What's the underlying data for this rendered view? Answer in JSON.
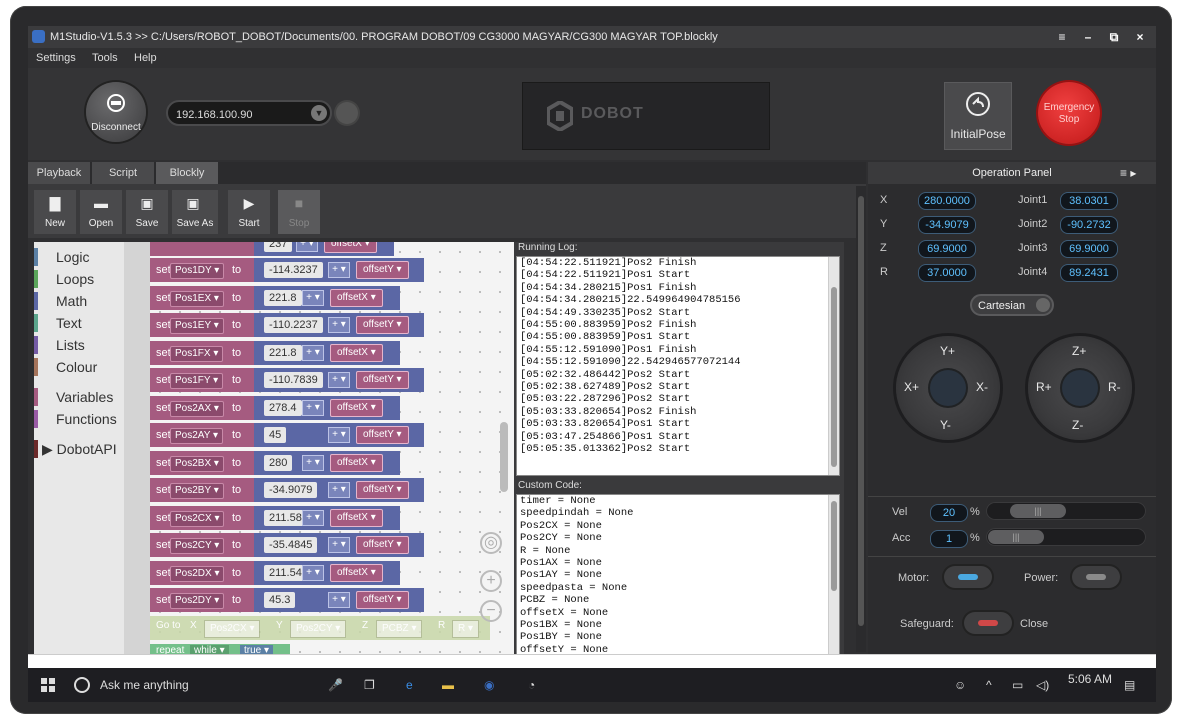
{
  "window": {
    "title": "M1Studio-V1.5.3 >> C:/Users/ROBOT_DOBOT/Documents/00. PROGRAM DOBOT/09 CG3000 MAGYAR/CG300 MAGYAR TOP.blockly",
    "controls": [
      "≡",
      "–",
      "⧉",
      "×"
    ]
  },
  "menu": {
    "settings": "Settings",
    "tools": "Tools",
    "help": "Help"
  },
  "connection": {
    "disconnect_label": "Disconnect",
    "ip": "192.168.100.90"
  },
  "brand": {
    "name": "DOBOT"
  },
  "actions": {
    "initial_pose": "InitialPose",
    "emergency_line1": "Emergency",
    "emergency_line2": "Stop"
  },
  "tabs": {
    "playback": "Playback",
    "script": "Script",
    "blockly": "Blockly"
  },
  "toolbar": {
    "new": "New",
    "open": "Open",
    "save": "Save",
    "save_as": "Save As",
    "start": "Start",
    "stop": "Stop"
  },
  "categories": [
    {
      "label": "Logic",
      "color": "#5b80a5"
    },
    {
      "label": "Loops",
      "color": "#5ba55b"
    },
    {
      "label": "Math",
      "color": "#5b67a5"
    },
    {
      "label": "Text",
      "color": "#5ba58c"
    },
    {
      "label": "Lists",
      "color": "#745ba5"
    },
    {
      "label": "Colour",
      "color": "#a5745b"
    },
    {
      "label": "Variables",
      "color": "#a55b80"
    },
    {
      "label": "Functions",
      "color": "#995ba5"
    },
    {
      "label": "▶ DobotAPI",
      "color": "#6b2a2a"
    }
  ],
  "blocks": {
    "top_partial": {
      "value": "237",
      "op": "+ ▾",
      "offset": "offsetX ▾"
    },
    "rows": [
      {
        "set": "set",
        "var": "Pos1DY ▾",
        "to": "to",
        "value": "-114.3237",
        "op": "+ ▾",
        "offset": "offsetY ▾"
      },
      {
        "set": "set",
        "var": "Pos1EX ▾",
        "to": "to",
        "value": "221.8",
        "op": "+ ▾",
        "offset": "offsetX ▾"
      },
      {
        "set": "set",
        "var": "Pos1EY ▾",
        "to": "to",
        "value": "-110.2237",
        "op": "+ ▾",
        "offset": "offsetY ▾"
      },
      {
        "set": "set",
        "var": "Pos1FX ▾",
        "to": "to",
        "value": "221.8",
        "op": "+ ▾",
        "offset": "offsetX ▾"
      },
      {
        "set": "set",
        "var": "Pos1FY ▾",
        "to": "to",
        "value": "-110.7839",
        "op": "+ ▾",
        "offset": "offsetY ▾"
      },
      {
        "set": "set",
        "var": "Pos2AX ▾",
        "to": "to",
        "value": "278.4",
        "op": "+ ▾",
        "offset": "offsetX ▾"
      },
      {
        "set": "set",
        "var": "Pos2AY ▾",
        "to": "to",
        "value": "45",
        "op": "+ ▾",
        "offset": "offsetY ▾"
      },
      {
        "set": "set",
        "var": "Pos2BX ▾",
        "to": "to",
        "value": "280",
        "op": "+ ▾",
        "offset": "offsetX ▾"
      },
      {
        "set": "set",
        "var": "Pos2BY ▾",
        "to": "to",
        "value": "-34.9079",
        "op": "+ ▾",
        "offset": "offsetY ▾"
      },
      {
        "set": "set",
        "var": "Pos2CX ▾",
        "to": "to",
        "value": "211.58",
        "op": "+ ▾",
        "offset": "offsetX ▾"
      },
      {
        "set": "set",
        "var": "Pos2CY ▾",
        "to": "to",
        "value": "-35.4845",
        "op": "+ ▾",
        "offset": "offsetY ▾"
      },
      {
        "set": "set",
        "var": "Pos2DX ▾",
        "to": "to",
        "value": "211.54",
        "op": "+ ▾",
        "offset": "offsetX ▾"
      },
      {
        "set": "set",
        "var": "Pos2DY ▾",
        "to": "to",
        "value": "45.3",
        "op": "+ ▾",
        "offset": "offsetY ▾"
      }
    ],
    "goto": {
      "label": "Go to",
      "x": "X",
      "xv": "Pos2CX ▾",
      "y": "Y",
      "yv": "Pos2CY ▾",
      "z": "Z",
      "zv": "PCBZ ▾",
      "r": "R",
      "rv": "R ▾"
    },
    "repeat": {
      "label": "repeat",
      "mode": "while ▾",
      "cond": "true ▾"
    }
  },
  "running_log": {
    "label": "Running Log:",
    "lines": [
      "[04:54:22.511921]Pos2 Finish",
      "[04:54:22.511921]Pos1 Start",
      "[04:54:34.280215]Pos1 Finish",
      "[04:54:34.280215]22.549964904785156",
      "[04:54:49.330235]Pos2 Start",
      "[04:55:00.883959]Pos2 Finish",
      "[04:55:00.883959]Pos1 Start",
      "[04:55:12.591090]Pos1 Finish",
      "[04:55:12.591090]22.542946577072144",
      "[05:02:32.486442]Pos2 Start",
      "[05:02:38.627489]Pos2 Start",
      "[05:03:22.287296]Pos2 Start",
      "[05:03:33.820654]Pos2 Finish",
      "[05:03:33.820654]Pos1 Start",
      "[05:03:47.254866]Pos1 Start",
      "[05:05:35.013362]Pos2 Start"
    ]
  },
  "custom_code": {
    "label": "Custom Code:",
    "lines": [
      "timer = None",
      "speedpindah = None",
      "Pos2CX = None",
      "Pos2CY = None",
      "R = None",
      "Pos1AX = None",
      "Pos1AY = None",
      "speedpasta = None",
      "PCBZ = None",
      "offsetX = None",
      "Pos1BX = None",
      "Pos1BY = None",
      "offsetY = None"
    ]
  },
  "operation_panel": {
    "title": "Operation Panel",
    "coords": [
      {
        "axis": "X",
        "value": "280.0000",
        "joint": "Joint1",
        "jvalue": "38.0301"
      },
      {
        "axis": "Y",
        "value": "-34.9079",
        "joint": "Joint2",
        "jvalue": "-90.2732"
      },
      {
        "axis": "Z",
        "value": "69.9000",
        "joint": "Joint3",
        "jvalue": "69.9000"
      },
      {
        "axis": "R",
        "value": "37.0000",
        "joint": "Joint4",
        "jvalue": "89.2431"
      }
    ],
    "mode": "Cartesian",
    "jog_xy": {
      "up": "Y+",
      "down": "Y-",
      "left": "X+",
      "right": "X-"
    },
    "jog_zr": {
      "up": "Z+",
      "down": "Z-",
      "left": "R+",
      "right": "R-"
    },
    "vel": {
      "label": "Vel",
      "value": "20",
      "unit": "%"
    },
    "acc": {
      "label": "Acc",
      "value": "1",
      "unit": "%"
    },
    "motor_label": "Motor:",
    "power_label": "Power:",
    "safeguard_label": "Safeguard:",
    "safeguard_state": "Close",
    "motor_color": "#4aa8e0",
    "power_color": "#8a8a8a",
    "safeguard_color": "#d04848"
  },
  "taskbar": {
    "search": "Ask me anything",
    "time": "5:06 AM"
  }
}
